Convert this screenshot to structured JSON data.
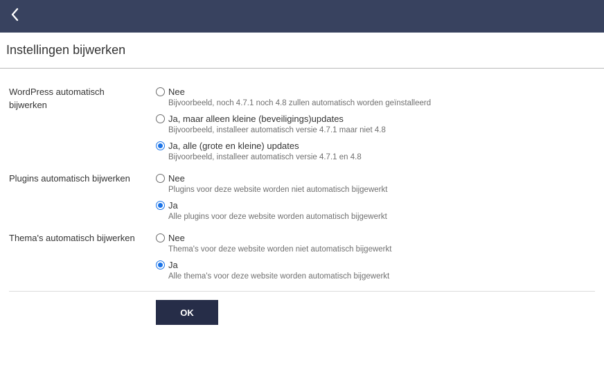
{
  "header": {
    "back_icon": "chevron-left-icon",
    "bar_color": "#38425f"
  },
  "page": {
    "title": "Instellingen bijwerken"
  },
  "settings": {
    "wordpress": {
      "label": "WordPress automatisch bijwerken",
      "options": [
        {
          "label": "Nee",
          "description": "Bijvoorbeeld, noch 4.7.1 noch 4.8 zullen automatisch worden geïnstalleerd",
          "checked": false
        },
        {
          "label": "Ja, maar alleen kleine (beveiligings)updates",
          "description": "Bijvoorbeeld, installeer automatisch versie 4.7.1 maar niet 4.8",
          "checked": false
        },
        {
          "label": "Ja, alle (grote en kleine) updates",
          "description": "Bijvoorbeeld, installeer automatisch versie 4.7.1 en 4.8",
          "checked": true
        }
      ]
    },
    "plugins": {
      "label": "Plugins automatisch bijwerken",
      "options": [
        {
          "label": "Nee",
          "description": "Plugins voor deze website worden niet automatisch bijgewerkt",
          "checked": false
        },
        {
          "label": "Ja",
          "description": "Alle plugins voor deze website worden automatisch bijgewerkt",
          "checked": true
        }
      ]
    },
    "themes": {
      "label": "Thema's automatisch bijwerken",
      "options": [
        {
          "label": "Nee",
          "description": "Thema's voor deze website worden niet automatisch bijgewerkt",
          "checked": false
        },
        {
          "label": "Ja",
          "description": "Alle thema's voor deze website worden automatisch bijgewerkt",
          "checked": true
        }
      ]
    }
  },
  "actions": {
    "ok_label": "OK",
    "ok_color": "#262d48"
  },
  "colors": {
    "radio_accent": "#1a73e8"
  }
}
